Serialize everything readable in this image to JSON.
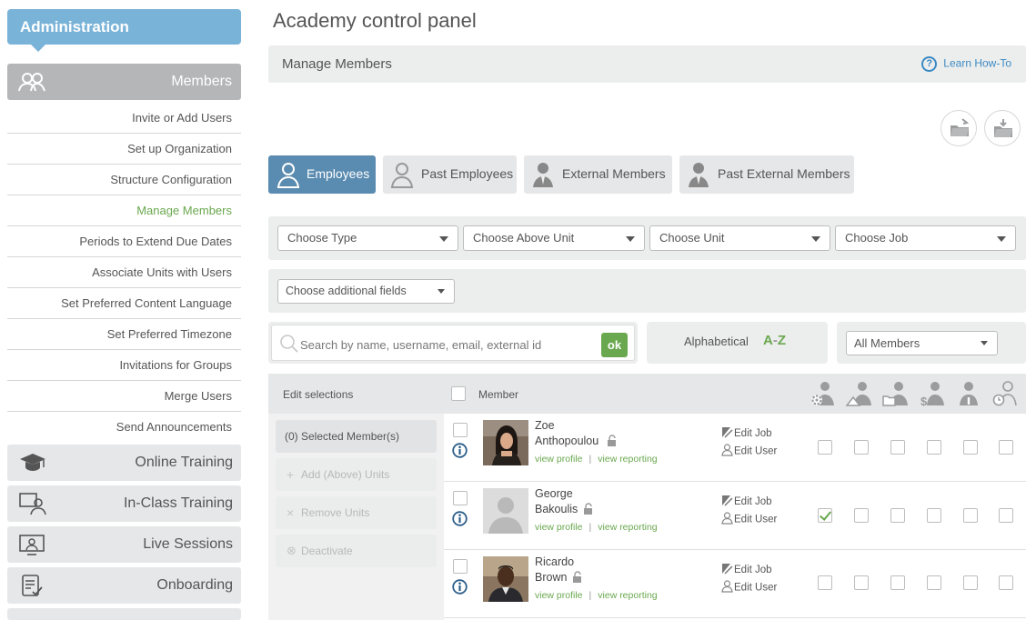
{
  "sidebar": {
    "admin_title": "Administration",
    "members_label": "Members",
    "items": [
      "Invite or Add Users",
      "Set up Organization",
      "Structure Configuration",
      "Manage Members",
      "Periods to Extend Due Dates",
      "Associate Units with Users",
      "Set Preferred Content Language",
      "Set Preferred Timezone",
      "Invitations for Groups",
      "Merge Users",
      "Send Announcements"
    ],
    "active_item": "Manage Members",
    "sections": [
      "Online Training",
      "In-Class Training",
      "Live Sessions",
      "Onboarding"
    ]
  },
  "page": {
    "title": "Academy control panel",
    "subtitle": "Manage Members",
    "howto_label": "Learn How-To"
  },
  "tabs": [
    {
      "label": "Employees",
      "icon": "user-outline-icon",
      "active": true
    },
    {
      "label": "Past Employees",
      "icon": "user-outline-icon",
      "active": false
    },
    {
      "label": "External Members",
      "icon": "user-suit-icon",
      "active": false
    },
    {
      "label": "Past External Members",
      "icon": "user-suit-icon",
      "active": false
    }
  ],
  "filters": {
    "type": "Choose Type",
    "above_unit": "Choose Above Unit",
    "unit": "Choose Unit",
    "job": "Choose Job",
    "additional": "Choose additional fields"
  },
  "search": {
    "placeholder": "Search by name, username, email, external id",
    "ok_label": "ok"
  },
  "sort": {
    "label": "Alphabetical",
    "az_a": "A",
    "az_dash": "-",
    "az_z": "Z"
  },
  "member_filter": "All Members",
  "table": {
    "edit_selections": "Edit selections",
    "member_header": "Member",
    "role_icons": [
      "admin-gear-icon",
      "unit-manager-icon",
      "content-manager-icon",
      "finance-manager-icon",
      "info-user-icon",
      "timer-user-icon"
    ]
  },
  "actions": {
    "selected_count": "(0) Selected Member(s)",
    "add_units": "Add (Above) Units",
    "remove_units": "Remove Units",
    "deactivate": "Deactivate"
  },
  "members": [
    {
      "first": "Zoe",
      "last": "Anthopoulou",
      "view_profile": "view profile",
      "view_reporting": "view reporting",
      "edit_job": "Edit Job",
      "edit_user": "Edit User",
      "roles": [
        false,
        false,
        false,
        false,
        false,
        false
      ],
      "photo": "woman"
    },
    {
      "first": "George",
      "last": "Bakoulis",
      "view_profile": "view profile",
      "view_reporting": "view reporting",
      "edit_job": "Edit Job",
      "edit_user": "Edit User",
      "roles": [
        true,
        false,
        false,
        false,
        false,
        false
      ],
      "photo": "placeholder"
    },
    {
      "first": "Ricardo",
      "last": "Brown",
      "view_profile": "view profile",
      "view_reporting": "view reporting",
      "edit_job": "Edit Job",
      "edit_user": "Edit User",
      "roles": [
        false,
        false,
        false,
        false,
        false,
        false
      ],
      "photo": "man"
    }
  ],
  "colors": {
    "accent_green": "#6aa84f",
    "admin_blue": "#7ab3d8",
    "tab_active": "#5a8bb0",
    "link_blue": "#3b8ac4"
  }
}
